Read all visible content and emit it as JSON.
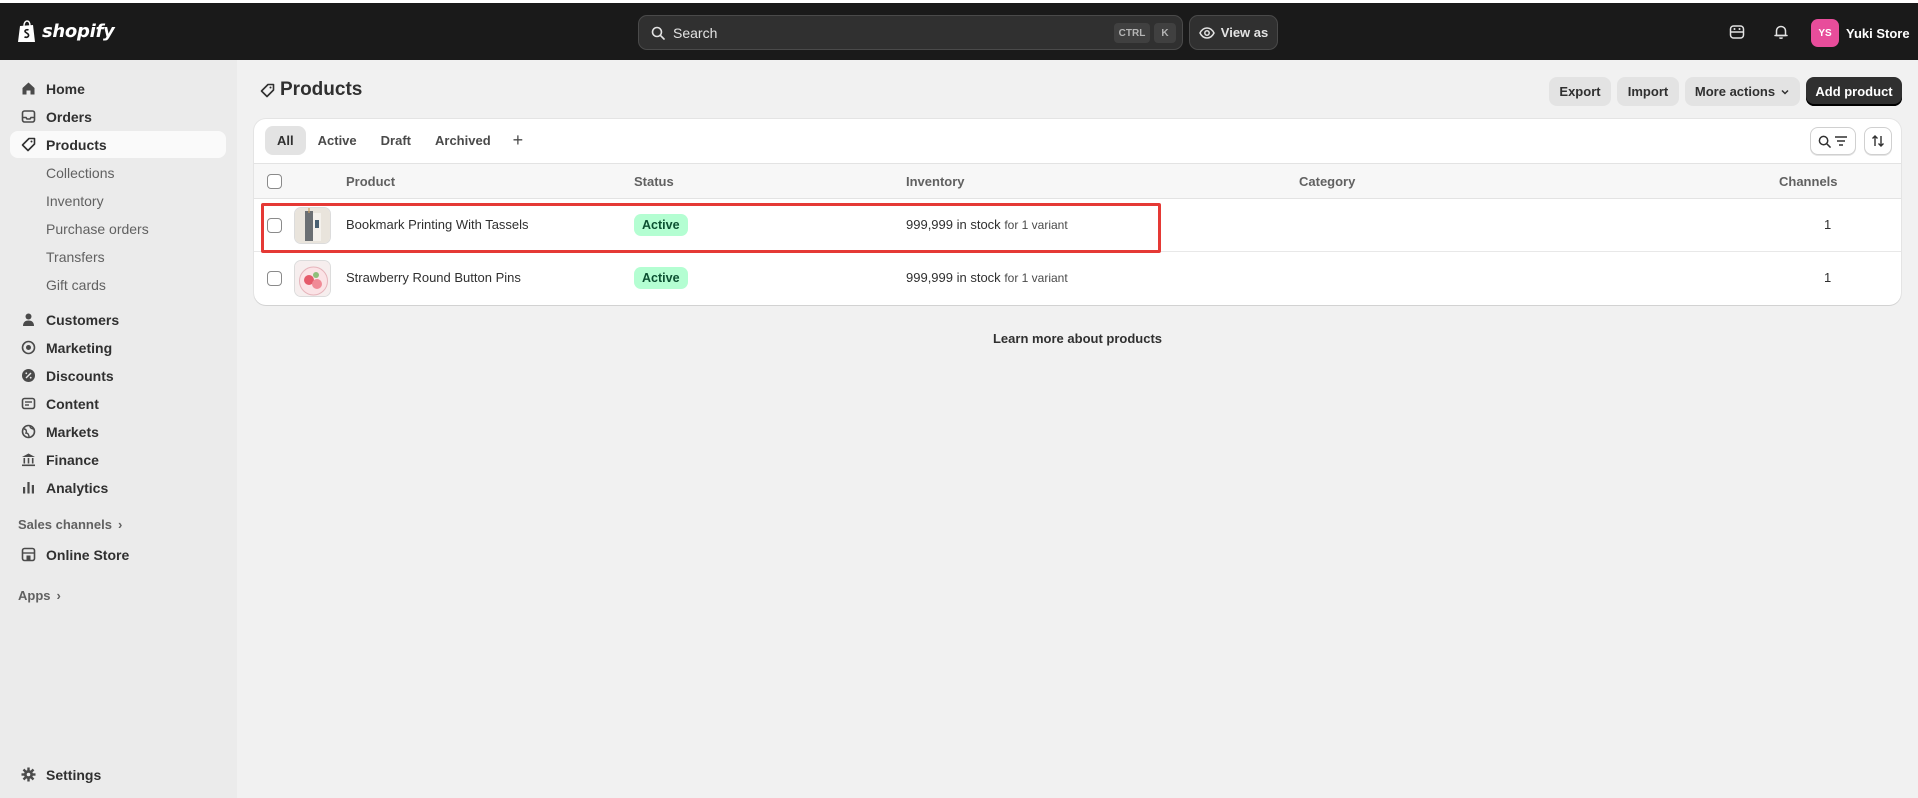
{
  "brand": {
    "name": "shopify"
  },
  "topbar": {
    "search_placeholder": "Search",
    "shortcut_ctrl": "CTRL",
    "shortcut_k": "K",
    "view_as": "View as",
    "avatar_initials": "YS",
    "store_name": "Yuki Store",
    "avatar_color": "#e84d9b"
  },
  "sidebar": {
    "home": "Home",
    "orders": "Orders",
    "products": "Products",
    "sub": [
      "Collections",
      "Inventory",
      "Purchase orders",
      "Transfers",
      "Gift cards"
    ],
    "customers": "Customers",
    "marketing": "Marketing",
    "discounts": "Discounts",
    "content": "Content",
    "markets": "Markets",
    "finance": "Finance",
    "analytics": "Analytics",
    "sales_channels": "Sales channels",
    "online_store": "Online Store",
    "apps": "Apps",
    "settings": "Settings"
  },
  "page": {
    "title": "Products",
    "export": "Export",
    "import": "Import",
    "more_actions": "More actions",
    "add_product": "Add product",
    "learn_more": "Learn more about products"
  },
  "tabs": [
    "All",
    "Active",
    "Draft",
    "Archived"
  ],
  "table": {
    "columns": [
      "Product",
      "Status",
      "Inventory",
      "Category",
      "Channels"
    ],
    "rows": [
      {
        "product": "Bookmark Printing With Tassels",
        "status": "Active",
        "inventory": "999,999 in stock",
        "variants": "for 1 variant",
        "category": "",
        "channels": "1"
      },
      {
        "product": "Strawberry Round Button Pins",
        "status": "Active",
        "inventory": "999,999 in stock",
        "variants": "for 1 variant",
        "category": "",
        "channels": "1"
      }
    ]
  },
  "colors": {
    "topbar": "#1a1a1a",
    "active_badge_bg": "#b4fed2",
    "active_badge_text": "#0c5132",
    "highlight": "#e53935"
  }
}
